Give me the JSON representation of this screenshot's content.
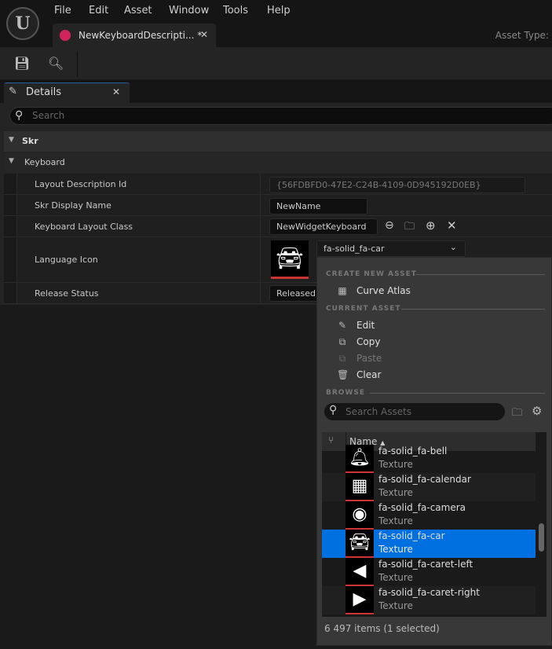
{
  "menu": [
    "File",
    "Edit",
    "Asset",
    "Window",
    "Tools",
    "Help"
  ],
  "document_tab": {
    "title": "NewKeyboardDescripti... *",
    "close": "✕"
  },
  "asset_type_label": "Asset Type:",
  "details_tab": {
    "title": "Details",
    "close": "✕"
  },
  "search": {
    "placeholder": "Search"
  },
  "sections": {
    "skr": "Skr",
    "keyboard": "Keyboard"
  },
  "properties": [
    {
      "label": "Layout Description Id",
      "value": "{56FDBFD0-47E2-C24B-4109-0D945192D0EB}"
    },
    {
      "label": "Skr Display Name",
      "value": "NewName"
    },
    {
      "label": "Keyboard Layout Class",
      "value": "NewWidgetKeyboard"
    },
    {
      "label": "Language Icon",
      "value": "fa-solid_fa-car"
    },
    {
      "label": "Release Status",
      "value": "Released"
    }
  ],
  "popup": {
    "create_header": "CREATE NEW ASSET",
    "create_items": [
      "Curve Atlas"
    ],
    "current_header": "CURRENT ASSET",
    "current_items": [
      "Edit",
      "Copy",
      "Paste",
      "Clear"
    ],
    "browse_header": "BROWSE",
    "search_placeholder": "Search Assets",
    "column_name": "Name",
    "assets": [
      {
        "name": "fa-solid_fa-bell",
        "type": "Texture",
        "icon": "bell"
      },
      {
        "name": "fa-solid_fa-calendar",
        "type": "Texture",
        "icon": "calendar"
      },
      {
        "name": "fa-solid_fa-camera",
        "type": "Texture",
        "icon": "camera"
      },
      {
        "name": "fa-solid_fa-car",
        "type": "Texture",
        "icon": "car",
        "selected": true
      },
      {
        "name": "fa-solid_fa-caret-left",
        "type": "Texture",
        "icon": "caret-left"
      },
      {
        "name": "fa-solid_fa-caret-right",
        "type": "Texture",
        "icon": "caret-right"
      }
    ],
    "footer": "6 497 items (1 selected)"
  },
  "colors": {
    "selection": "#0070e0",
    "tab_icon": "#d0245a",
    "thumb_underline": "#cc3333"
  }
}
